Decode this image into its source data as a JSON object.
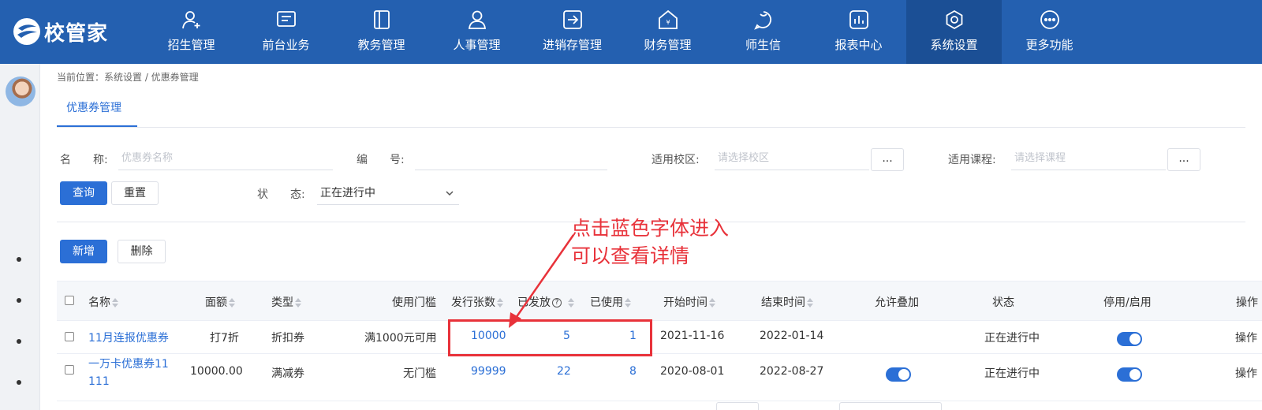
{
  "logo": {
    "text": "校管家"
  },
  "nav": [
    {
      "label": "招生管理",
      "icon": "user-add-icon"
    },
    {
      "label": "前台业务",
      "icon": "monitor-icon"
    },
    {
      "label": "教务管理",
      "icon": "book-icon"
    },
    {
      "label": "人事管理",
      "icon": "person-icon"
    },
    {
      "label": "进销存管理",
      "icon": "arrow-box-icon"
    },
    {
      "label": "财务管理",
      "icon": "money-bag-icon"
    },
    {
      "label": "师生信",
      "icon": "chat-bubble-icon"
    },
    {
      "label": "报表中心",
      "icon": "bar-chart-icon"
    },
    {
      "label": "系统设置",
      "icon": "gear-icon",
      "active": true
    },
    {
      "label": "更多功能",
      "icon": "more-icon"
    }
  ],
  "breadcrumb": "当前位置：系统设置 / 优惠券管理",
  "tab": {
    "label": "优惠券管理"
  },
  "filters": {
    "name_label": "名　　称:",
    "name_placeholder": "优惠券名称",
    "code_label": "编　　号:",
    "campus_label": "适用校区:",
    "campus_placeholder": "请选择校区",
    "course_label": "适用课程:",
    "course_placeholder": "请选择课程",
    "dots": "...",
    "status_label": "状　　态:",
    "status_value": "正在进行中"
  },
  "buttons": {
    "query": "查询",
    "reset": "重置",
    "add": "新增",
    "delete": "删除"
  },
  "table": {
    "headers": {
      "name": "名称",
      "amount": "面额",
      "type": "类型",
      "threshold": "使用门槛",
      "issued": "发行张数",
      "distributed": "已发放",
      "used": "已使用",
      "start": "开始时间",
      "end": "结束时间",
      "stack": "允许叠加",
      "status": "状态",
      "toggle": "停用/启用",
      "action": "操作"
    },
    "rows": [
      {
        "name": "11月连报优惠券",
        "amount": "打7折",
        "type": "折扣券",
        "threshold": "满1000元可用",
        "issued": "10000",
        "distributed": "5",
        "used": "1",
        "start": "2021-11-16",
        "end": "2022-01-14",
        "stack_on": false,
        "status": "正在进行中",
        "enabled": true,
        "action": "操作"
      },
      {
        "name_line1": "一万卡优惠券11",
        "name_line2": "111",
        "amount": "10000.00",
        "type": "满减券",
        "threshold": "无门槛",
        "issued": "99999",
        "distributed": "22",
        "used": "8",
        "start": "2020-08-01",
        "end": "2022-08-27",
        "stack_on": true,
        "status": "正在进行中",
        "enabled": true,
        "action": "操作"
      }
    ]
  },
  "annotation": {
    "line1": "点击蓝色字体进入",
    "line2": "可以查看详情",
    "color": "#e8323a"
  },
  "colors": {
    "nav_bg": "#2460b0",
    "accent": "#2b6fd6"
  }
}
